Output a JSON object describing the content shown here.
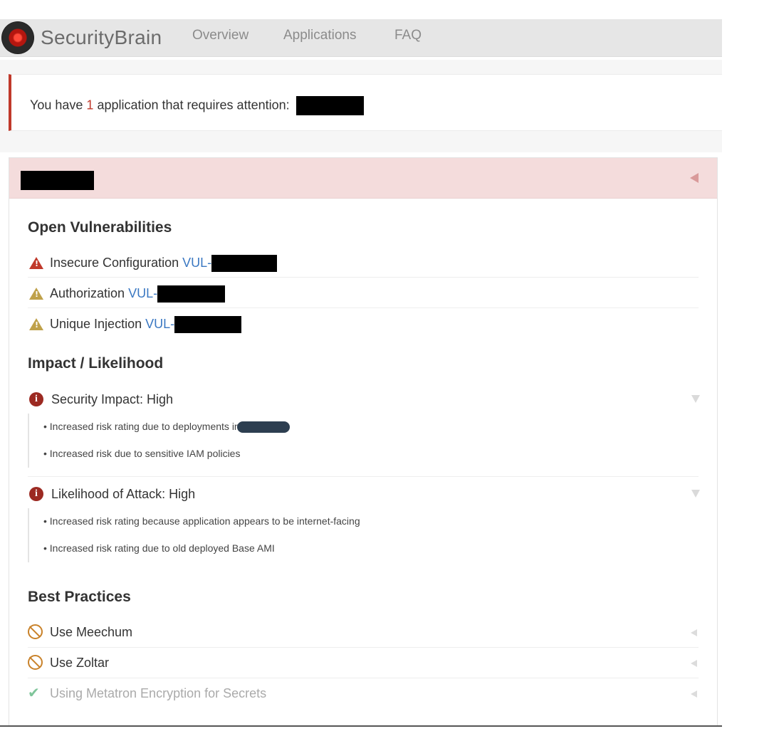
{
  "brand": "SecurityBrain",
  "nav": [
    "Overview",
    "Applications",
    "FAQ"
  ],
  "alert": {
    "prefix": "You have ",
    "count": "1",
    "suffix": " application that requires attention:"
  },
  "open_vulnerabilities": {
    "title": "Open Vulnerabilities",
    "items": [
      {
        "label": "Insecure Configuration ",
        "link_prefix": "VUL-",
        "severity": "high"
      },
      {
        "label": "Authorization ",
        "link_prefix": "VUL-",
        "severity": "medium"
      },
      {
        "label": "Unique Injection ",
        "link_prefix": "VUL-",
        "severity": "medium"
      }
    ]
  },
  "impact": {
    "title": "Impact / Likelihood",
    "blocks": [
      {
        "label": "Security Impact: High",
        "bullets": [
          "• Increased risk rating due to deployments in",
          "• Increased risk due to sensitive IAM policies"
        ]
      },
      {
        "label": "Likelihood of Attack: High",
        "bullets": [
          "• Increased risk rating because application appears to be internet-facing",
          "• Increased risk rating due to old deployed Base AMI"
        ]
      }
    ]
  },
  "best_practices": {
    "title": "Best Practices",
    "items": [
      {
        "label": "Use Meechum",
        "status": "not-used"
      },
      {
        "label": "Use Zoltar",
        "status": "not-used"
      },
      {
        "label": "Using Metatron Encryption for Secrets",
        "status": "used"
      }
    ]
  },
  "colors": {
    "alert_accent": "#c0392b",
    "panel_header": "#f4dcdc",
    "link": "#3b78c2"
  }
}
